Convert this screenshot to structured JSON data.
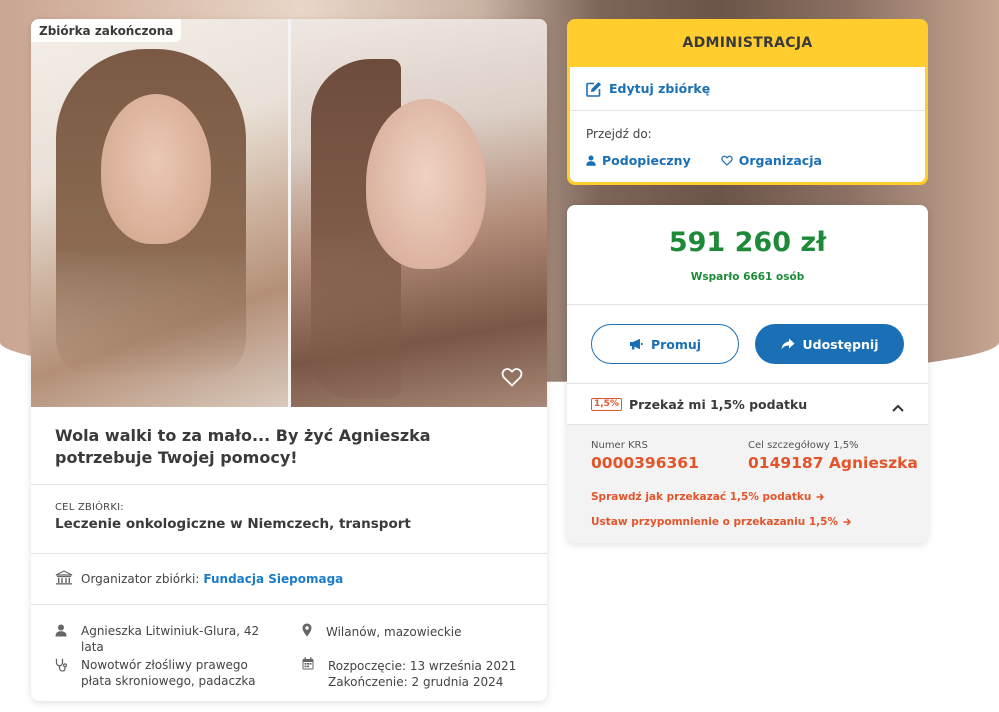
{
  "campaign": {
    "status_badge": "Zbiórka zakończona",
    "title": "Wola walki to za mało... By żyć Agnieszka potrzebuje Twojej pomocy!",
    "goal_label": "CEL ZBIÓRKI:",
    "goal_value": "Leczenie onkologiczne w Niemczech, transport",
    "organizer_label": "Organizator zbiórki:",
    "organizer_name": "Fundacja Siepomaga",
    "beneficiary": "Agnieszka Litwiniuk-Glura, 42 lata",
    "location": "Wilanów, mazowieckie",
    "diagnosis": "Nowotwór złośliwy prawego płata skroniowego, padaczka",
    "start_date": "Rozpoczęcie: 13 września 2021",
    "end_date": "Zakończenie: 2 grudnia 2024"
  },
  "admin": {
    "header": "ADMINISTRACJA",
    "edit_label": "Edytuj zbiórkę",
    "goto_label": "Przejdź do:",
    "link_beneficiary": "Podopieczny",
    "link_organization": "Organizacja"
  },
  "funding": {
    "amount": "591 260 zł",
    "supporters": "Wsparło 6661 osób",
    "promote_label": "Promuj",
    "share_label": "Udostępnij"
  },
  "tax": {
    "badge": "1,5%",
    "title": "Przekaż mi 1,5% podatku",
    "krs_label": "Numer KRS",
    "krs_value": "0000396361",
    "target_label": "Cel szczegółowy 1,5%",
    "target_value": "0149187 Agnieszka",
    "link_check": "Sprawdź jak przekazać 1,5% podatku",
    "link_reminder": "Ustaw przypomnienie o przekazaniu 1,5%"
  },
  "colors": {
    "accent_blue": "#1a6fb5",
    "success_green": "#1e8a39",
    "tax_orange": "#e2552b",
    "admin_yellow": "#ffcd2e"
  }
}
